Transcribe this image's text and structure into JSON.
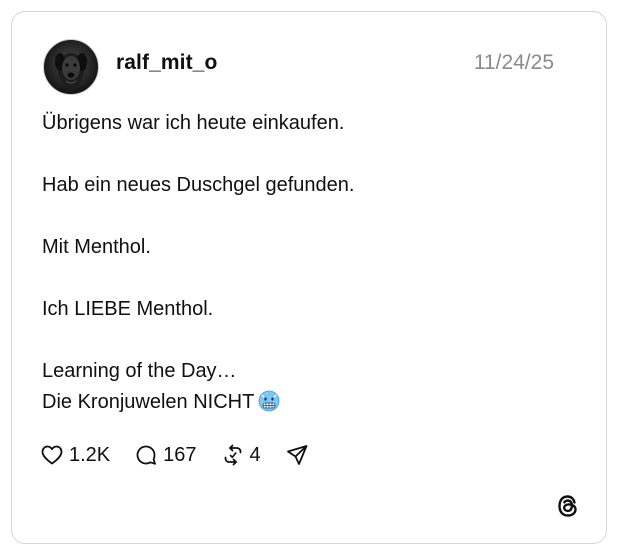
{
  "post": {
    "username": "ralf_mit_o",
    "date": "11/24/25",
    "lines": [
      "Übrigens war ich heute einkaufen.",
      "Hab ein neues Duschgel gefunden.",
      "Mit Menthol.",
      "Ich LIEBE Menthol.",
      "Learning of the Day…",
      "Die Kronjuwelen NICHT"
    ],
    "emoji": "cold-face-emoji"
  },
  "actions": {
    "likes": "1.2K",
    "replies": "167",
    "reposts": "4"
  },
  "icons": {
    "like": "heart-icon",
    "reply": "speech-bubble-icon",
    "repost": "repost-icon",
    "share": "send-icon",
    "brand": "threads-logo-icon"
  },
  "colors": {
    "text": "#101010",
    "muted": "#8a8a8a",
    "border": "#d6d6d6",
    "emoji": "#7ec8f2"
  }
}
